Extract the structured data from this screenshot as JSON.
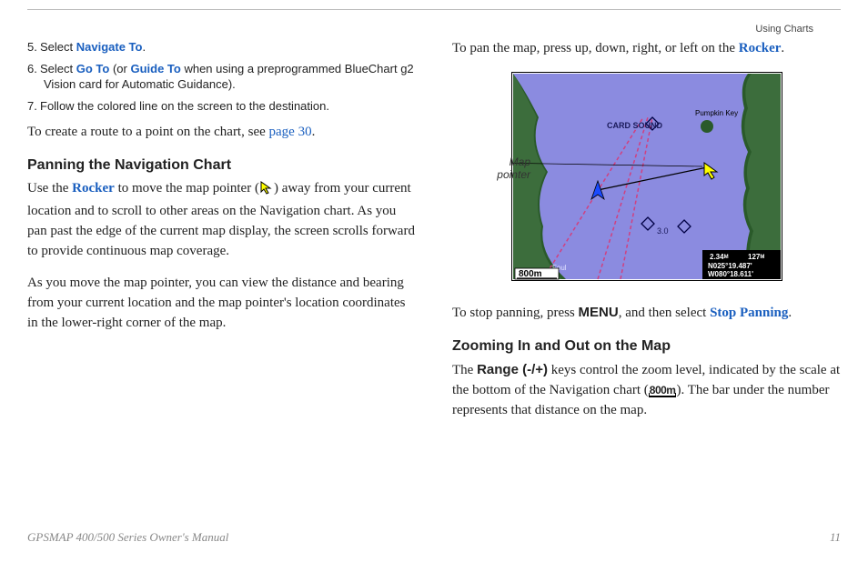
{
  "header": {
    "section": "Using Charts"
  },
  "left": {
    "steps": [
      {
        "n": "5.",
        "pre": "Select ",
        "b1": "Navigate To",
        "post": "."
      },
      {
        "n": "6.",
        "pre": "Select ",
        "b1": "Go To",
        "mid": " (or ",
        "b2": "Guide To",
        "post": " when using a preprogrammed BlueChart g2 Vision card for Automatic Guidance)."
      },
      {
        "n": "7.",
        "pre": "Follow the colored line on the screen to the destination."
      }
    ],
    "create_route_pre": "To create a route to a point on the chart, see ",
    "create_route_link": "page 30",
    "create_route_post": ".",
    "h_panning": "Panning the Navigation Chart",
    "panning_p1_a": "Use the ",
    "panning_p1_rocker": "Rocker",
    "panning_p1_b": " to move the map pointer (",
    "panning_p1_c": ") away from your current location and to scroll to other areas on the Navigation chart. As you pan past the edge of the current map display, the screen scrolls forward to provide continuous map coverage.",
    "panning_p2": "As you move the map pointer, you can view the distance and bearing from your current location and the map pointer's location coordinates in the lower-right corner of the map."
  },
  "right": {
    "pan_p_a": "To pan the map, press up, down, right, or left on the ",
    "pan_p_rocker": "Rocker",
    "pan_p_b": ".",
    "fig_label": "Map pointer",
    "map": {
      "label_card_sound": "CARD SOUND",
      "label_pumpkin": "Pumpkin Key",
      "depth": "3.0",
      "foul": "Foul",
      "scale": "800m",
      "info_dist": "2.34",
      "info_dist_u": "M",
      "info_brg": "127",
      "info_brg_u": "M",
      "info_lat": "N025°19.487'",
      "info_lon": "W080°18.611'"
    },
    "stop_a": "To stop panning, press ",
    "stop_menu": "MENU",
    "stop_b": ", and then select ",
    "stop_sp": "Stop Panning",
    "stop_c": ".",
    "h_zoom": "Zooming In and Out on the Map",
    "zoom_a": "The ",
    "zoom_range": "Range (-/+)",
    "zoom_b": " keys control the zoom level, indicated by the scale at the bottom of the Navigation chart (",
    "zoom_scale": "800m",
    "zoom_c": "). The bar under the number represents that distance on the map."
  },
  "footer": {
    "title": "GPSMAP 400/500 Series Owner's Manual",
    "page": "11"
  }
}
